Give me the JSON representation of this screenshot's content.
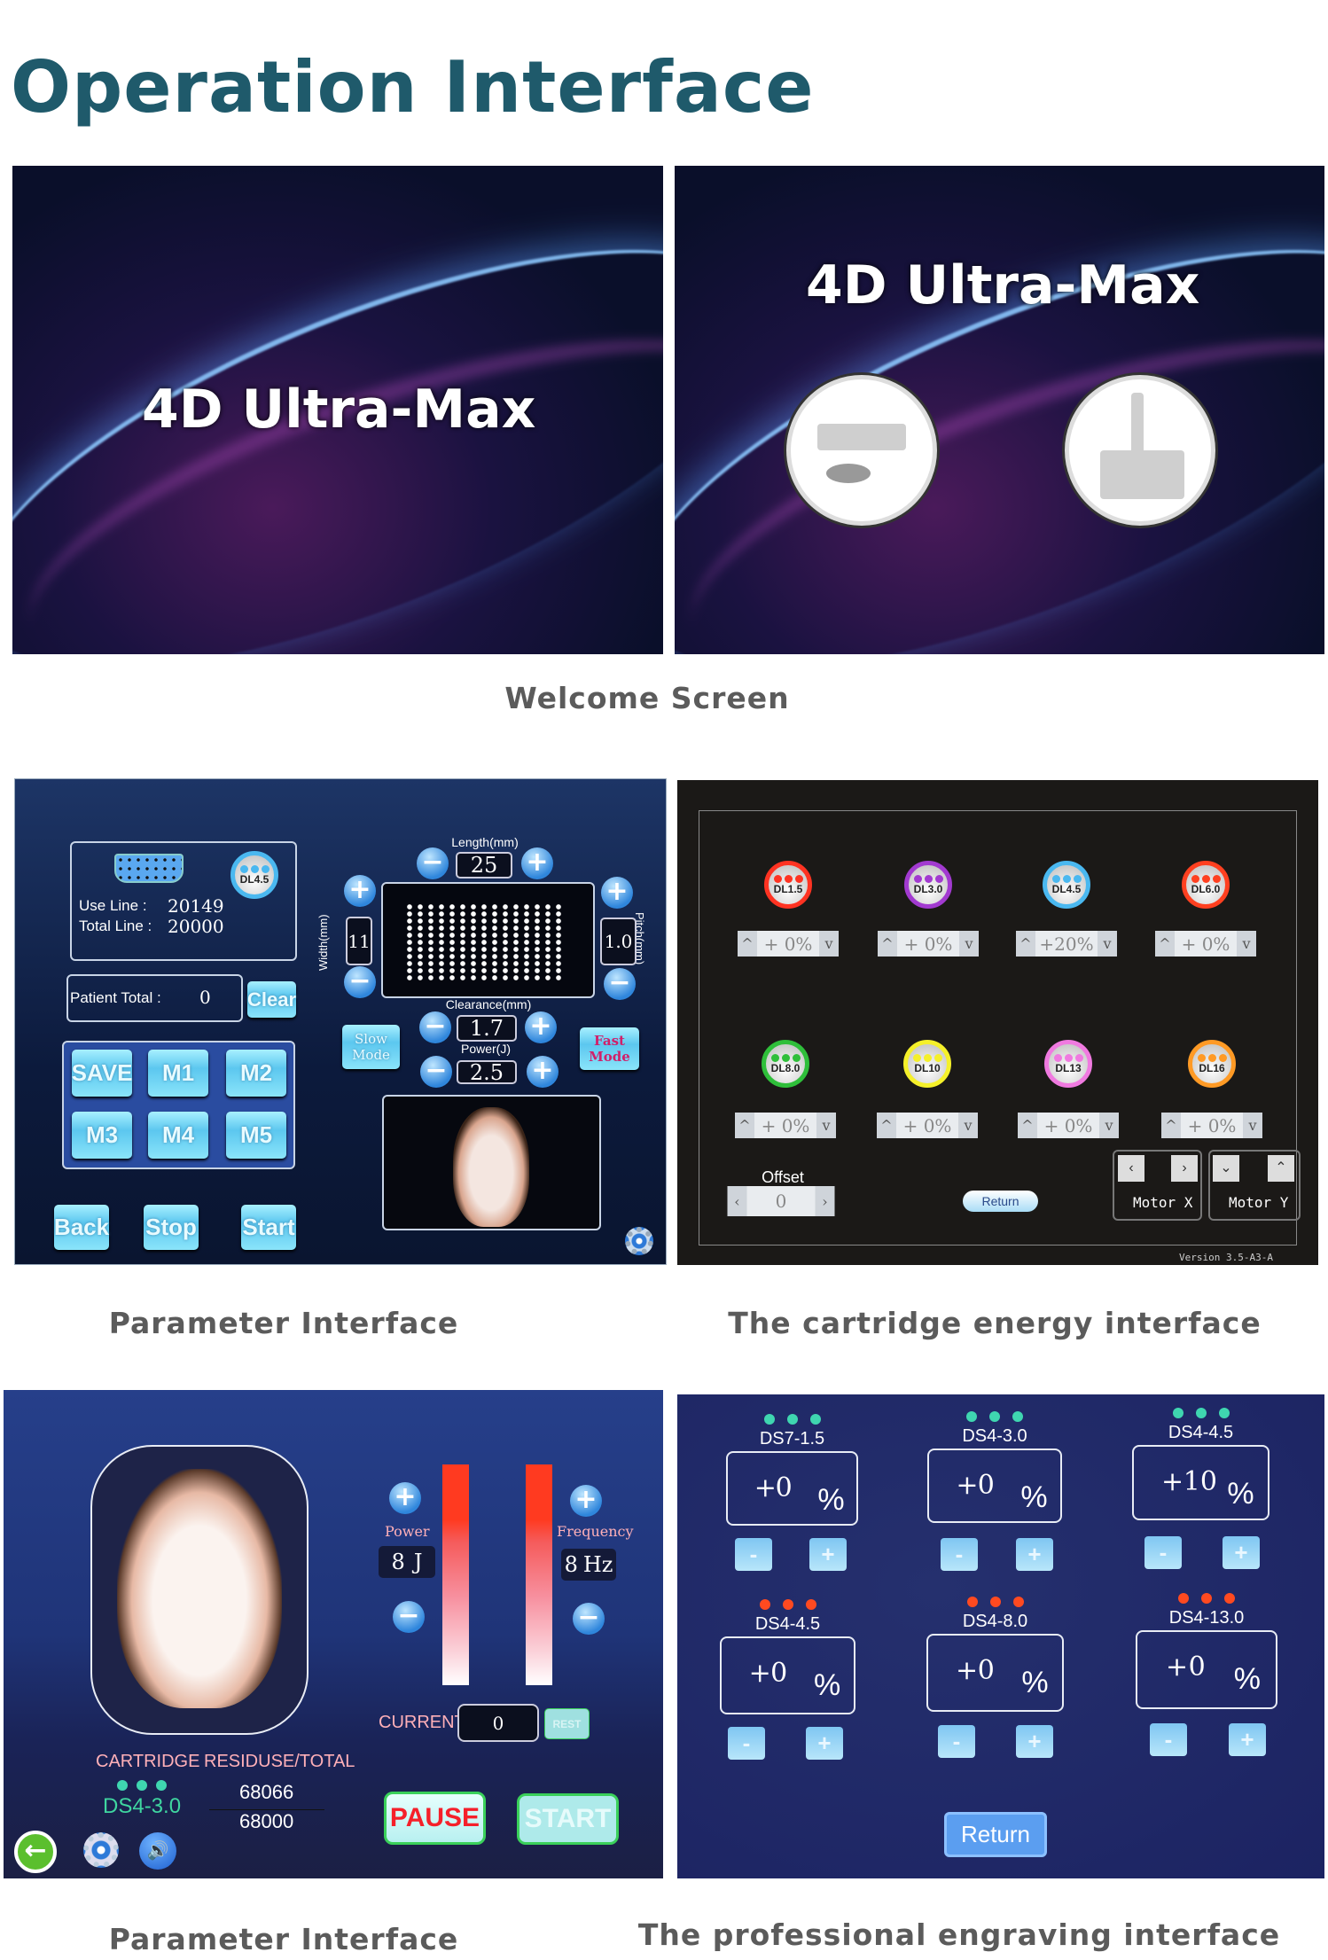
{
  "title": "Operation Interface",
  "captions": {
    "welcome": "Welcome Screen",
    "parameter1": "Parameter Interface",
    "cartridge": "The cartridge energy interface",
    "parameter2": "Parameter Interface",
    "engraving": "The professional engraving interface"
  },
  "welcome": {
    "brand_left": "4D Ultra-Max",
    "brand_right": "4D Ultra-Max"
  },
  "parameter": {
    "cartridge_badge": "DL4.5",
    "use_line_label": "Use Line :",
    "use_line_value": "20149",
    "total_line_label": "Total Line :",
    "total_line_value": "20000",
    "patient_total_label": "Patient Total :",
    "patient_total_value": "0",
    "clear": "Clear",
    "memory_buttons": [
      "SAVE",
      "M1",
      "M2",
      "M3",
      "M4",
      "M5"
    ],
    "back": "Back",
    "stop": "Stop",
    "start": "Start",
    "length_label": "Length(mm)",
    "length_value": "25",
    "width_label": "Width(mm)",
    "width_value": "11",
    "pitch_label": "Pitch(mm)",
    "pitch_value": "1.0",
    "clearance_label": "Clearance(mm)",
    "clearance_value": "1.7",
    "power_label": "Power(J)",
    "power_value": "2.5",
    "slow_mode": "Slow Mode",
    "fast_mode": "Fast Mode",
    "icons": [
      "vga-connector-icon",
      "gear-icon",
      "plus-icon",
      "minus-icon"
    ]
  },
  "cartridge": {
    "items": [
      {
        "name": "DL1.5",
        "value": "+ 0%",
        "color": "#ff3322"
      },
      {
        "name": "DL3.0",
        "value": "+ 0%",
        "color": "#a23ad0"
      },
      {
        "name": "DL4.5",
        "value": "+20%",
        "color": "#4ab8f0"
      },
      {
        "name": "DL6.0",
        "value": "+ 0%",
        "color": "#ff4020"
      },
      {
        "name": "DL8.0",
        "value": "+ 0%",
        "color": "#2fbf3a"
      },
      {
        "name": "DL10",
        "value": "+ 0%",
        "color": "#f5f02a"
      },
      {
        "name": "DL13",
        "value": "+ 0%",
        "color": "#f07ae0"
      },
      {
        "name": "DL16",
        "value": "+ 0%",
        "color": "#ff9a25"
      }
    ],
    "offset_label": "Offset",
    "offset_value": "0",
    "return": "Return",
    "motor_x": "Motor X",
    "motor_y": "Motor Y",
    "version": "Version 3.5-A3-A"
  },
  "parameter2": {
    "power_label": "Power",
    "power_value": "8",
    "power_unit": "J",
    "frequency_label": "Frequency",
    "frequency_value": "8",
    "frequency_unit": "Hz",
    "current_label": "CURRENT",
    "current_value": "0",
    "rest": "REST",
    "cartridge_label": "CARTRIDGE",
    "residuse_label": "RESIDUSE/TOTAL",
    "cartridge_name": "DS4-3.0",
    "residuse": "68066",
    "total": "68000",
    "pause": "PAUSE",
    "start": "START",
    "icons": [
      "back-arrow-icon",
      "gear-icon",
      "speaker-icon"
    ]
  },
  "engraving": {
    "items": [
      {
        "name": "DS7-1.5",
        "sign": "+",
        "value": "0",
        "unit": "%",
        "dot_color": "#3fd6b0"
      },
      {
        "name": "DS4-3.0",
        "sign": "+",
        "value": "0",
        "unit": "%",
        "dot_color": "#3fd6b0"
      },
      {
        "name": "DS4-4.5",
        "sign": "+",
        "value": "10",
        "unit": "%",
        "dot_color": "#3fd6b0"
      },
      {
        "name": "DS4-4.5",
        "sign": "+",
        "value": "0",
        "unit": "%",
        "dot_color": "#ff4a20"
      },
      {
        "name": "DS4-8.0",
        "sign": "+",
        "value": "0",
        "unit": "%",
        "dot_color": "#ff4a20"
      },
      {
        "name": "DS4-13.0",
        "sign": "+",
        "value": "0",
        "unit": "%",
        "dot_color": "#ff4a20"
      }
    ],
    "minus": "-",
    "plus": "+",
    "return": "Return"
  }
}
